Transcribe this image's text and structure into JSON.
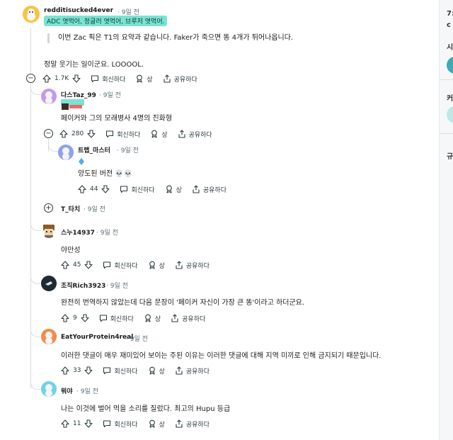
{
  "comments": {
    "c0": {
      "user": "redditisucked4ever",
      "time": "9일 전",
      "flair": "ADC 엿먹어, 정글러 엿먹어, 브루저 엿먹어.",
      "quote": "이번 Zac 픽은 T1의 요약과 같습니다. Faker가 죽으면 똥 4개가 튀어나옵니다.",
      "text": "정말 웃기는 일이군요. LOOOOL.",
      "votes": "1.7K"
    },
    "c1": {
      "user": "다스Taz_99",
      "time": "9일 전",
      "text": "페이커와 그의 모래병사 4명의 진화형",
      "votes": "280"
    },
    "c2": {
      "user": "트랩_마스터",
      "time": "9일 전",
      "text": "양도된 버전 💀💀",
      "votes": "44"
    },
    "c3": {
      "user": "T_타치",
      "time": "9일 전"
    },
    "c4": {
      "user": "스누14937",
      "time": "9일 전",
      "text": "야만성",
      "votes": "45"
    },
    "c5": {
      "user": "조직Rich3923",
      "time": "9일 전",
      "text": "완전히 번역하지 않았는데 다음 문장이 '페이커 자신이 가장 큰 똥'이라고 하더군요.",
      "votes": "9"
    },
    "c6": {
      "user": "EatYourProtein4real",
      "time": "9일 전",
      "text": "이러한 댓글이 매우 재미있어 보이는 주된 이유는 이러한 댓글에 대해 지역 미끼로 인해 금지되기 때문입니다.",
      "votes": "33"
    },
    "c7": {
      "user": "뭐야",
      "time": "9일 전",
      "text": "나는 이것에 벌어 먹을 소리를 질렀다. 최고의 Hupu 등급",
      "votes": "11"
    }
  },
  "actions": {
    "reply": "회신하다",
    "award": "상",
    "share": "공유하다"
  },
  "toggles": {
    "collapse": "−",
    "expand": "+"
  },
  "sidebar": {
    "s1": "7:",
    "s2": "c",
    "s3": "시",
    "s4": "커",
    "s5": "규"
  },
  "colors": {
    "flair_bg": "#7be3d3",
    "thread": "#d7dde0"
  }
}
